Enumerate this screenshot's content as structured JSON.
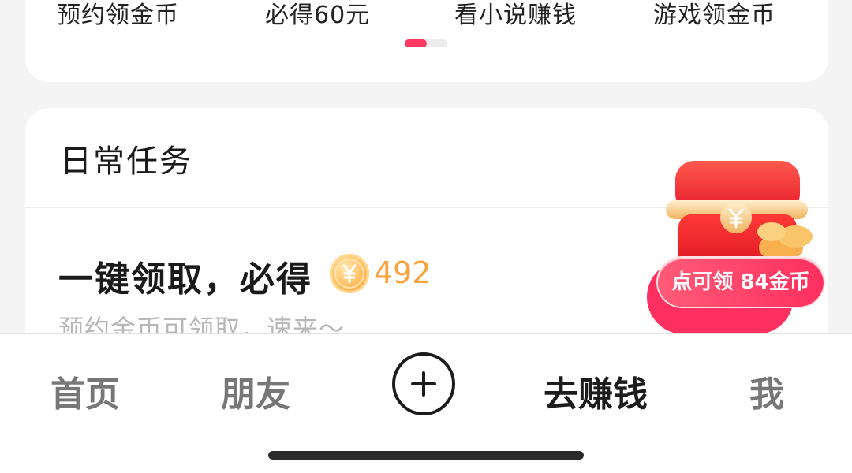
{
  "top_tabs": [
    {
      "label": "预约领金币"
    },
    {
      "label": "必得60元"
    },
    {
      "label": "看小说赚钱"
    },
    {
      "label": "游戏领金币"
    }
  ],
  "task_section": {
    "title": "日常任务",
    "task": {
      "title": "一键领取，必得",
      "reward_icon": "coin-icon",
      "reward": "492",
      "subtitle": "预约金币可领取，速来～"
    }
  },
  "floating_reward": {
    "icon": "treasure-chest-icon",
    "label": "点可领 84金币"
  },
  "bottom_nav": {
    "home": "首页",
    "friends": "朋友",
    "create_icon": "plus-circle-icon",
    "earn": "去赚钱",
    "me": "我"
  },
  "colors": {
    "accent": "#fe3a64",
    "coin_text": "#f9a13a",
    "active_nav": "#1c1c1c",
    "inactive_nav": "#777777"
  },
  "pager": {
    "active_index": 0,
    "count": 2
  }
}
